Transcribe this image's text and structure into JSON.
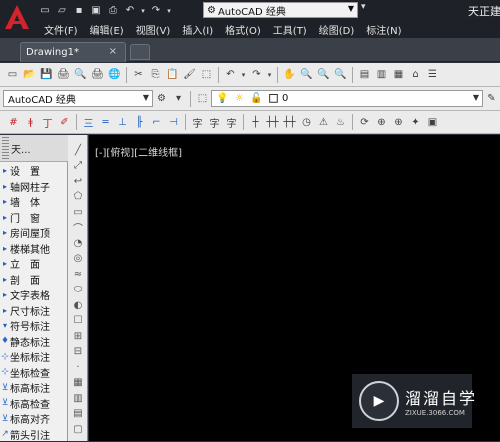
{
  "app": {
    "title": "天正建"
  },
  "quick_access": {
    "icons": [
      "new-file-icon",
      "open-file-icon",
      "save-icon",
      "save-as-icon",
      "print-icon",
      "undo-icon",
      "undo-dropdown-icon",
      "redo-icon",
      "redo-dropdown-icon"
    ],
    "workspace": "AutoCAD 经典",
    "workspace_glyph": "⚙"
  },
  "menu": [
    "文件(F)",
    "编辑(E)",
    "视图(V)",
    "插入(I)",
    "格式(O)",
    "工具(T)",
    "绘图(D)",
    "标注(N)"
  ],
  "tabs": {
    "doc": "Drawing1*",
    "close": "×"
  },
  "toolbar1": {
    "glyphs": [
      "▭",
      "📂",
      "💾",
      "🖨",
      "🔍",
      "🖨",
      "🌐",
      "✂",
      "⎘",
      "📋",
      "🖌",
      "⬚",
      "↶",
      "▾",
      "↷",
      "▾",
      "✋",
      "🔍",
      "🔍",
      "🔍",
      "▤",
      "▥",
      "▦",
      "⌂",
      "☰"
    ]
  },
  "toolbar2": {
    "style_combo": "AutoCAD 经典",
    "gear": "⚙",
    "layer_glyphs": [
      "⬚",
      "💡",
      "☼",
      "🔓",
      "■"
    ],
    "layer_value": "0"
  },
  "toolbar3": {
    "glyphs": [
      "#",
      "ǂ",
      "丁",
      "✐",
      "三",
      "═",
      "⊥",
      "╟",
      "⌐",
      "⊣",
      "字",
      "字",
      "字",
      "┼",
      "┼┼",
      "┼┼",
      "◷",
      "⚠",
      "♨",
      "⟳",
      "⊕",
      "⊕",
      "✦",
      "▣"
    ]
  },
  "panel": {
    "header": "天...",
    "items": [
      {
        "label": "设　置",
        "marker": "▸"
      },
      {
        "label": "轴网柱子",
        "marker": "▸"
      },
      {
        "label": "墙　体",
        "marker": "▸"
      },
      {
        "label": "门　窗",
        "marker": "▸"
      },
      {
        "label": "房间屋顶",
        "marker": "▸"
      },
      {
        "label": "楼梯其他",
        "marker": "▸"
      },
      {
        "label": "立　面",
        "marker": "▸"
      },
      {
        "label": "剖　面",
        "marker": "▸"
      },
      {
        "label": "文字表格",
        "marker": "▸"
      },
      {
        "label": "尺寸标注",
        "marker": "▸"
      },
      {
        "label": "符号标注",
        "marker": "▾"
      },
      {
        "label": "静态标注",
        "marker": "♦"
      },
      {
        "label": "坐标标注",
        "marker": "⊹"
      },
      {
        "label": "坐标检查",
        "marker": "⊹"
      },
      {
        "label": "标高标注",
        "marker": "⊻"
      },
      {
        "label": "标高检查",
        "marker": "⊻"
      },
      {
        "label": "标高对齐",
        "marker": "⊻"
      },
      {
        "label": "箭头引注",
        "marker": "↗"
      }
    ]
  },
  "draw_tools": [
    "╱",
    "⤢",
    "↩",
    "⬠",
    "▭",
    "⌒",
    "◔",
    "◎",
    "≈",
    "⬭",
    "◐",
    "☐",
    "⊞",
    "⊟",
    "·",
    "▦",
    "▥",
    "▤",
    "▢"
  ],
  "canvas": {
    "view_label": "[-][俯视][二维线框]"
  },
  "watermark": {
    "title": "溜溜自学",
    "url": "ZIXUE.3066.COM",
    "logo_glyph": "▶"
  }
}
